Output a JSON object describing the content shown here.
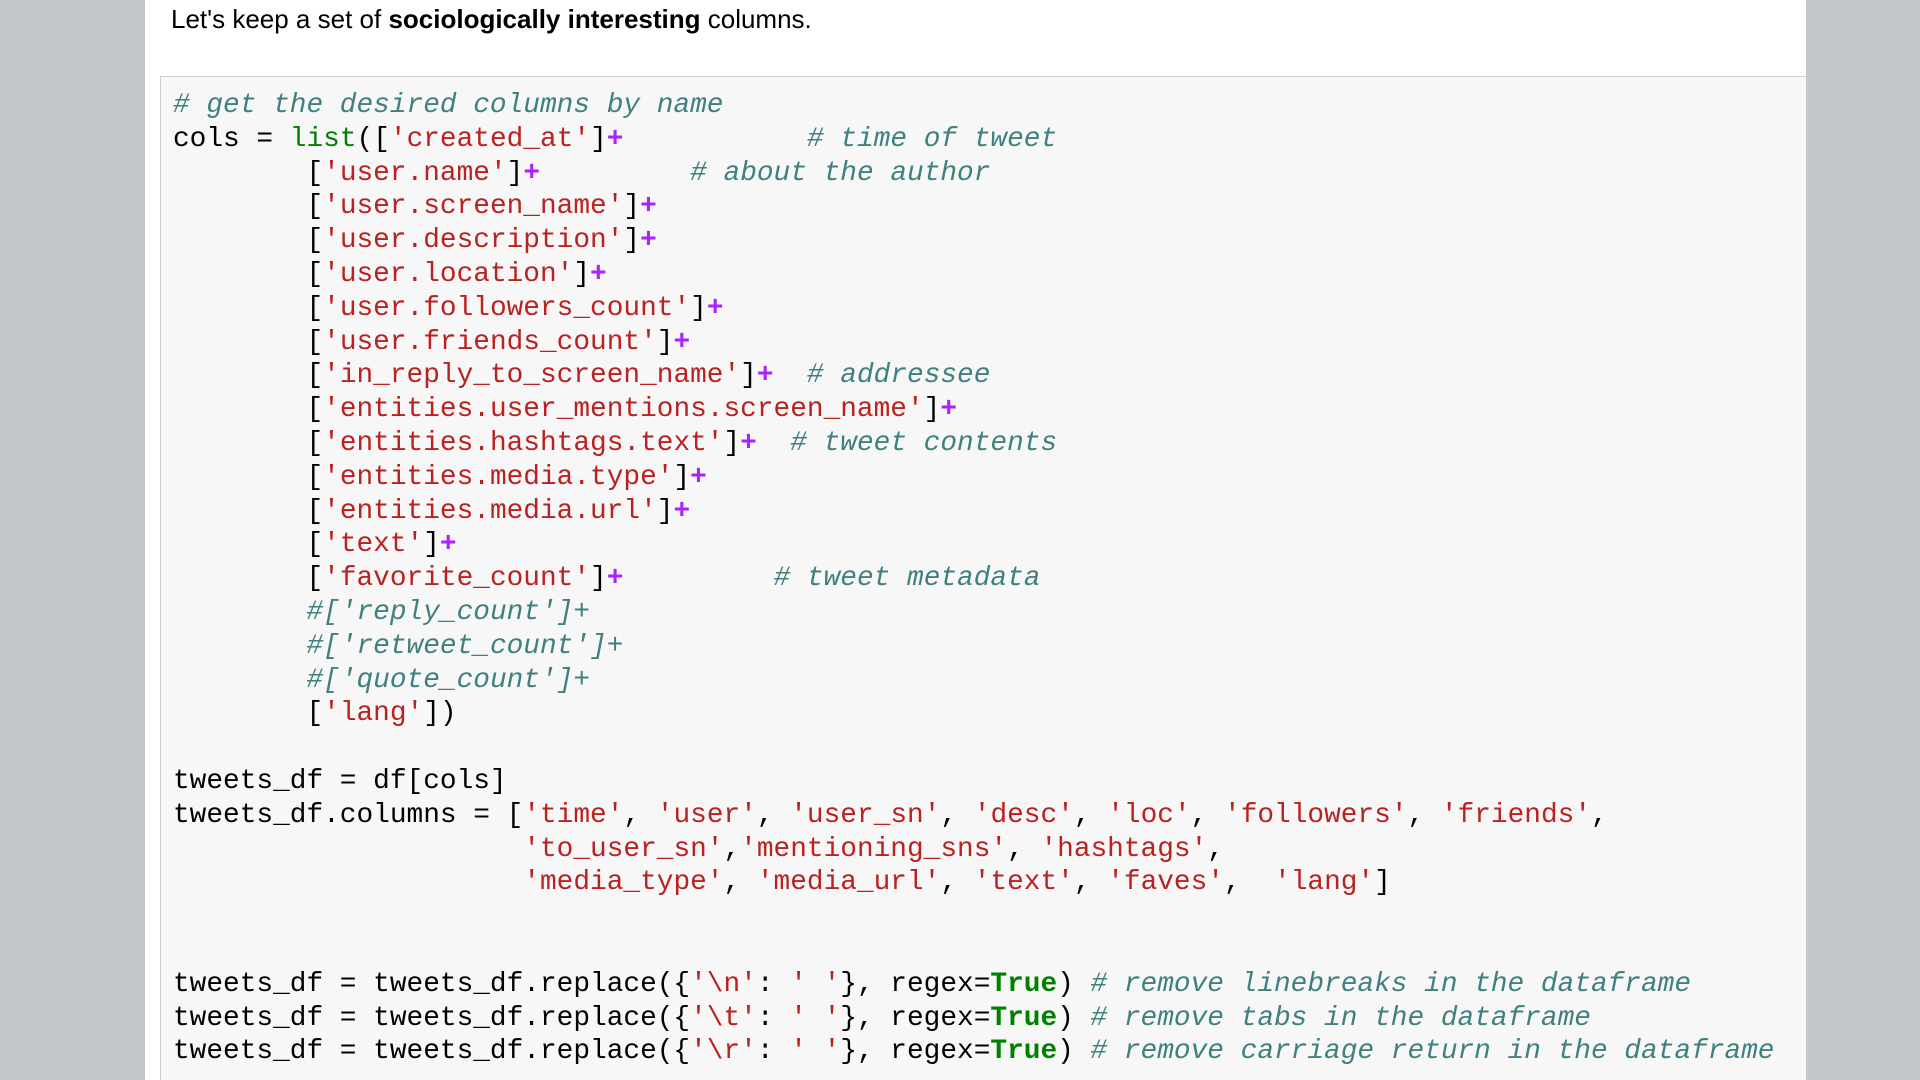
{
  "notebook": {
    "markdown_cell": {
      "prefix": "Let's keep a set of ",
      "bold": "sociologically interesting",
      "suffix": " columns."
    },
    "code_cell": {
      "language": "python",
      "lines": [
        [
          [
            "c",
            "# get the desired columns by name"
          ]
        ],
        [
          [
            "t",
            "cols = "
          ],
          [
            "b",
            "list"
          ],
          [
            "t",
            "(["
          ],
          [
            "s",
            "'created_at'"
          ],
          [
            "t",
            "]"
          ],
          [
            "o",
            "+"
          ],
          [
            "t",
            "           "
          ],
          [
            "c",
            "# time of tweet"
          ]
        ],
        [
          [
            "t",
            "        ["
          ],
          [
            "s",
            "'user.name'"
          ],
          [
            "t",
            "]"
          ],
          [
            "o",
            "+"
          ],
          [
            "t",
            "         "
          ],
          [
            "c",
            "# about the author"
          ]
        ],
        [
          [
            "t",
            "        ["
          ],
          [
            "s",
            "'user.screen_name'"
          ],
          [
            "t",
            "]"
          ],
          [
            "o",
            "+"
          ]
        ],
        [
          [
            "t",
            "        ["
          ],
          [
            "s",
            "'user.description'"
          ],
          [
            "t",
            "]"
          ],
          [
            "o",
            "+"
          ]
        ],
        [
          [
            "t",
            "        ["
          ],
          [
            "s",
            "'user.location'"
          ],
          [
            "t",
            "]"
          ],
          [
            "o",
            "+"
          ]
        ],
        [
          [
            "t",
            "        ["
          ],
          [
            "s",
            "'user.followers_count'"
          ],
          [
            "t",
            "]"
          ],
          [
            "o",
            "+"
          ]
        ],
        [
          [
            "t",
            "        ["
          ],
          [
            "s",
            "'user.friends_count'"
          ],
          [
            "t",
            "]"
          ],
          [
            "o",
            "+"
          ]
        ],
        [
          [
            "t",
            "        ["
          ],
          [
            "s",
            "'in_reply_to_screen_name'"
          ],
          [
            "t",
            "]"
          ],
          [
            "o",
            "+"
          ],
          [
            "t",
            "  "
          ],
          [
            "c",
            "# addressee"
          ]
        ],
        [
          [
            "t",
            "        ["
          ],
          [
            "s",
            "'entities.user_mentions.screen_name'"
          ],
          [
            "t",
            "]"
          ],
          [
            "o",
            "+"
          ]
        ],
        [
          [
            "t",
            "        ["
          ],
          [
            "s",
            "'entities.hashtags.text'"
          ],
          [
            "t",
            "]"
          ],
          [
            "o",
            "+"
          ],
          [
            "t",
            "  "
          ],
          [
            "c",
            "# tweet contents"
          ]
        ],
        [
          [
            "t",
            "        ["
          ],
          [
            "s",
            "'entities.media.type'"
          ],
          [
            "t",
            "]"
          ],
          [
            "o",
            "+"
          ]
        ],
        [
          [
            "t",
            "        ["
          ],
          [
            "s",
            "'entities.media.url'"
          ],
          [
            "t",
            "]"
          ],
          [
            "o",
            "+"
          ]
        ],
        [
          [
            "t",
            "        ["
          ],
          [
            "s",
            "'text'"
          ],
          [
            "t",
            "]"
          ],
          [
            "o",
            "+"
          ]
        ],
        [
          [
            "t",
            "        ["
          ],
          [
            "s",
            "'favorite_count'"
          ],
          [
            "t",
            "]"
          ],
          [
            "o",
            "+"
          ],
          [
            "t",
            "         "
          ],
          [
            "c",
            "# tweet metadata"
          ]
        ],
        [
          [
            "t",
            "        "
          ],
          [
            "c",
            "#['reply_count']+"
          ]
        ],
        [
          [
            "t",
            "        "
          ],
          [
            "c",
            "#['retweet_count']+"
          ]
        ],
        [
          [
            "t",
            "        "
          ],
          [
            "c",
            "#['quote_count']+"
          ]
        ],
        [
          [
            "t",
            "        ["
          ],
          [
            "s",
            "'lang'"
          ],
          [
            "t",
            "])"
          ]
        ],
        [],
        [
          [
            "t",
            "tweets_df = df[cols]"
          ]
        ],
        [
          [
            "t",
            "tweets_df.columns = ["
          ],
          [
            "s",
            "'time'"
          ],
          [
            "t",
            ", "
          ],
          [
            "s",
            "'user'"
          ],
          [
            "t",
            ", "
          ],
          [
            "s",
            "'user_sn'"
          ],
          [
            "t",
            ", "
          ],
          [
            "s",
            "'desc'"
          ],
          [
            "t",
            ", "
          ],
          [
            "s",
            "'loc'"
          ],
          [
            "t",
            ", "
          ],
          [
            "s",
            "'followers'"
          ],
          [
            "t",
            ", "
          ],
          [
            "s",
            "'friends'"
          ],
          [
            "t",
            ","
          ]
        ],
        [
          [
            "t",
            "                     "
          ],
          [
            "s",
            "'to_user_sn'"
          ],
          [
            "t",
            ","
          ],
          [
            "s",
            "'mentioning_sns'"
          ],
          [
            "t",
            ", "
          ],
          [
            "s",
            "'hashtags'"
          ],
          [
            "t",
            ","
          ]
        ],
        [
          [
            "t",
            "                     "
          ],
          [
            "s",
            "'media_type'"
          ],
          [
            "t",
            ", "
          ],
          [
            "s",
            "'media_url'"
          ],
          [
            "t",
            ", "
          ],
          [
            "s",
            "'text'"
          ],
          [
            "t",
            ", "
          ],
          [
            "s",
            "'faves'"
          ],
          [
            "t",
            ",  "
          ],
          [
            "s",
            "'lang'"
          ],
          [
            "t",
            "]"
          ]
        ],
        [],
        [],
        [
          [
            "t",
            "tweets_df = tweets_df.replace({"
          ],
          [
            "s",
            "'\\n'"
          ],
          [
            "t",
            ": "
          ],
          [
            "s",
            "' '"
          ],
          [
            "t",
            "}, regex="
          ],
          [
            "k",
            "True"
          ],
          [
            "t",
            ") "
          ],
          [
            "c",
            "# remove linebreaks in the dataframe"
          ]
        ],
        [
          [
            "t",
            "tweets_df = tweets_df.replace({"
          ],
          [
            "s",
            "'\\t'"
          ],
          [
            "t",
            ": "
          ],
          [
            "s",
            "' '"
          ],
          [
            "t",
            "}, regex="
          ],
          [
            "k",
            "True"
          ],
          [
            "t",
            ") "
          ],
          [
            "c",
            "# remove tabs in the dataframe"
          ]
        ],
        [
          [
            "t",
            "tweets_df = tweets_df.replace({"
          ],
          [
            "s",
            "'\\r'"
          ],
          [
            "t",
            ": "
          ],
          [
            "s",
            "' '"
          ],
          [
            "t",
            "}, regex="
          ],
          [
            "k",
            "True"
          ],
          [
            "t",
            ") "
          ],
          [
            "c",
            "# remove carriage return in the dataframe"
          ]
        ]
      ]
    }
  }
}
